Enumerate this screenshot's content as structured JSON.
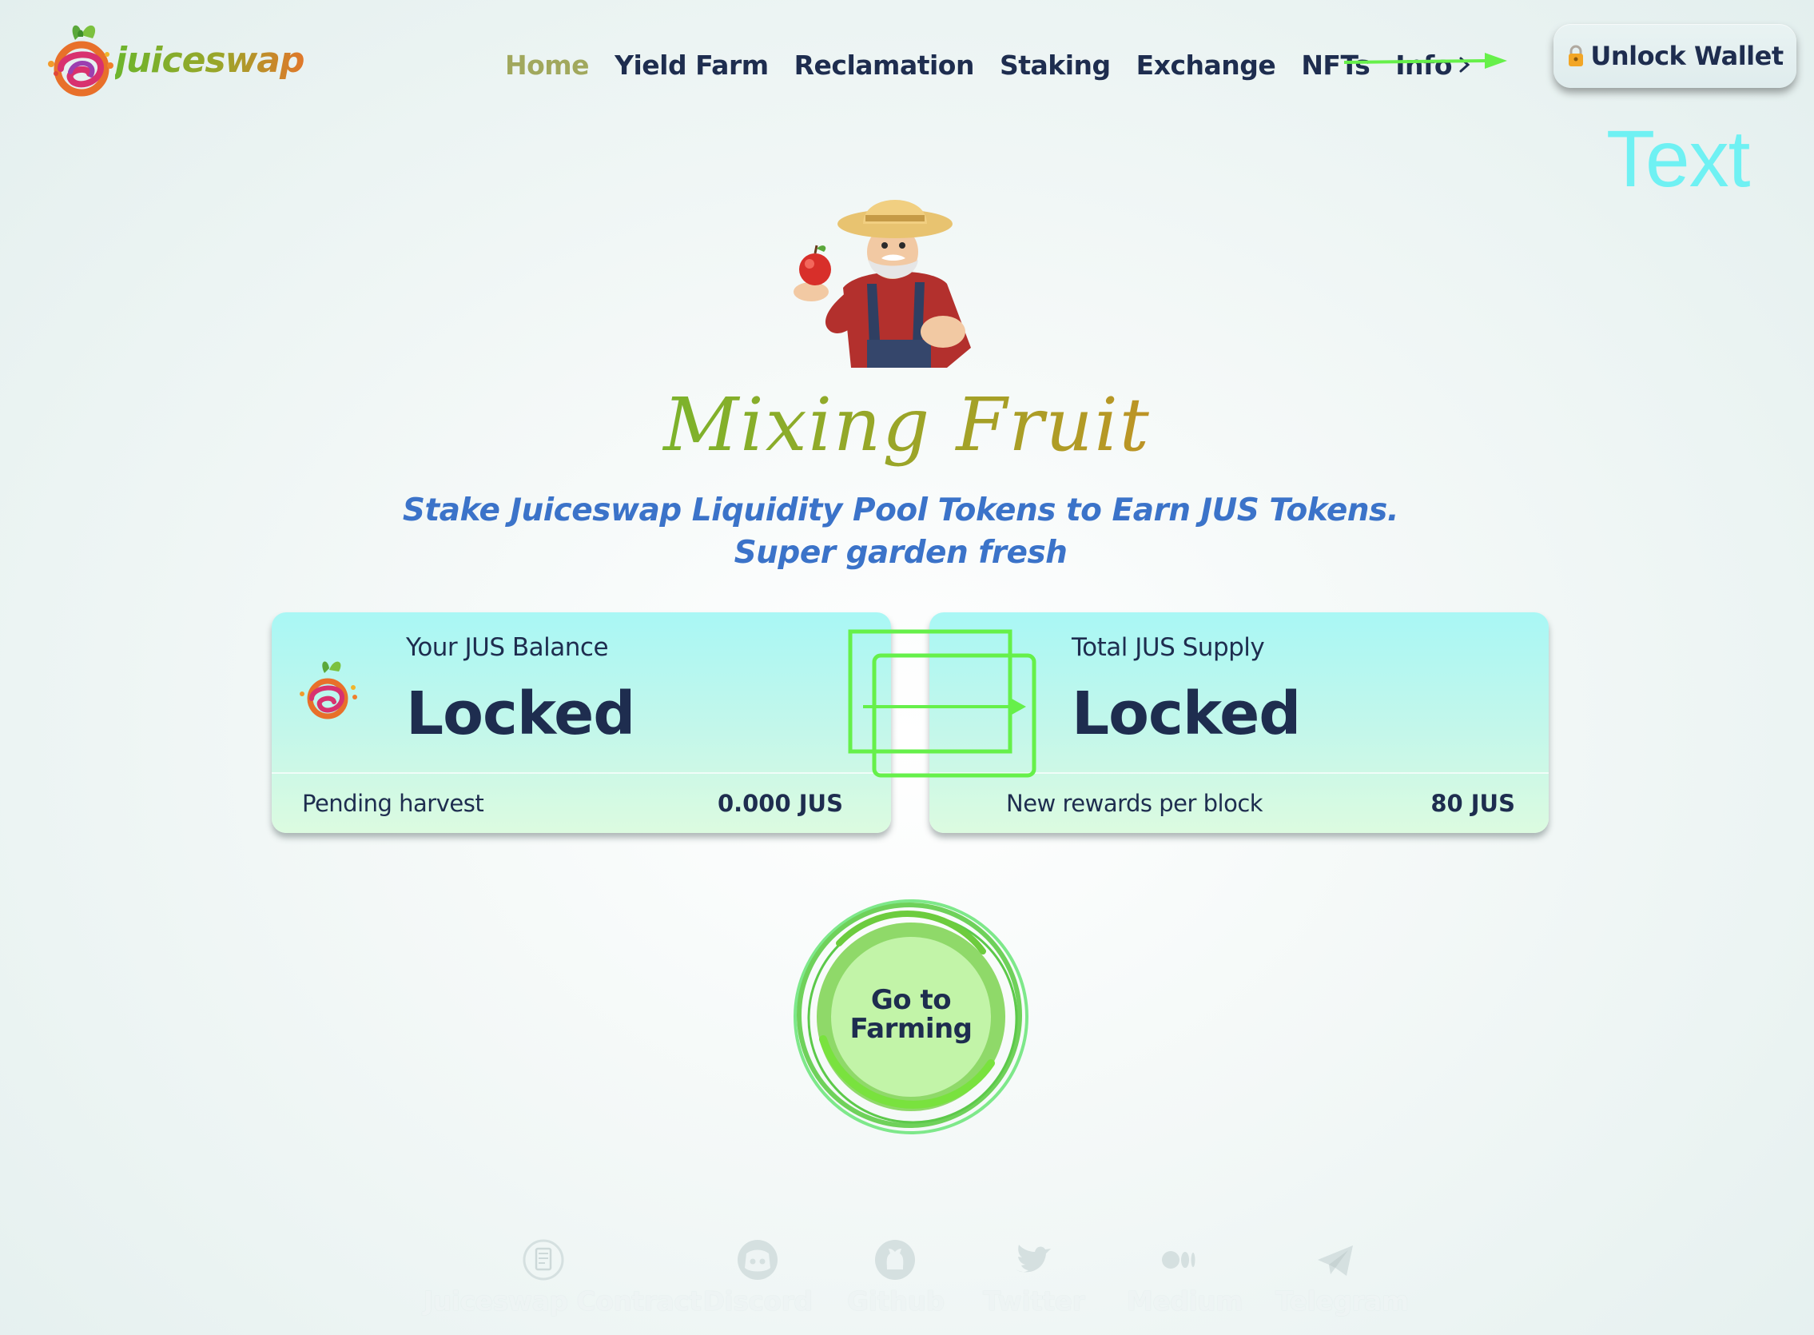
{
  "header": {
    "logo_text": "juiceswap",
    "nav": [
      {
        "label": "Home",
        "active": true
      },
      {
        "label": "Yield Farm",
        "active": false
      },
      {
        "label": "Reclamation",
        "active": false
      },
      {
        "label": "Staking",
        "active": false
      },
      {
        "label": "Exchange",
        "active": false
      },
      {
        "label": "NFTs",
        "active": false
      },
      {
        "label": "Info",
        "active": false
      }
    ],
    "unlock_label": "Unlock Wallet",
    "overlay_text": "Text"
  },
  "hero": {
    "title": "Mixing Fruit",
    "subtitle_line1": "Stake Juiceswap Liquidity Pool Tokens to Earn JUS Tokens.",
    "subtitle_line2": "Super garden fresh"
  },
  "cards": {
    "balance": {
      "label": "Your JUS Balance",
      "value": "Locked",
      "footer_label": "Pending harvest",
      "footer_value": "0.000 JUS"
    },
    "supply": {
      "label": "Total JUS Supply",
      "value": "Locked",
      "footer_label": "New rewards per block",
      "footer_value": "80 JUS"
    }
  },
  "farm_button": {
    "line1": "Go to",
    "line2": "Farming"
  },
  "footer": {
    "links": [
      {
        "label": "Juiceswap Contract",
        "icon": "contract-icon"
      },
      {
        "label": "Discord",
        "icon": "discord-icon"
      },
      {
        "label": "Github",
        "icon": "github-icon"
      },
      {
        "label": "Twitter",
        "icon": "twitter-icon"
      },
      {
        "label": "Medium",
        "icon": "medium-icon"
      },
      {
        "label": "Telegram",
        "icon": "telegram-icon"
      }
    ]
  },
  "colors": {
    "nav_text": "#1e2d4f",
    "nav_active": "#a1a85d",
    "subtitle": "#3b73c9",
    "annotation_green": "#66f04a",
    "annotation_cyan": "#6ff1f3"
  }
}
